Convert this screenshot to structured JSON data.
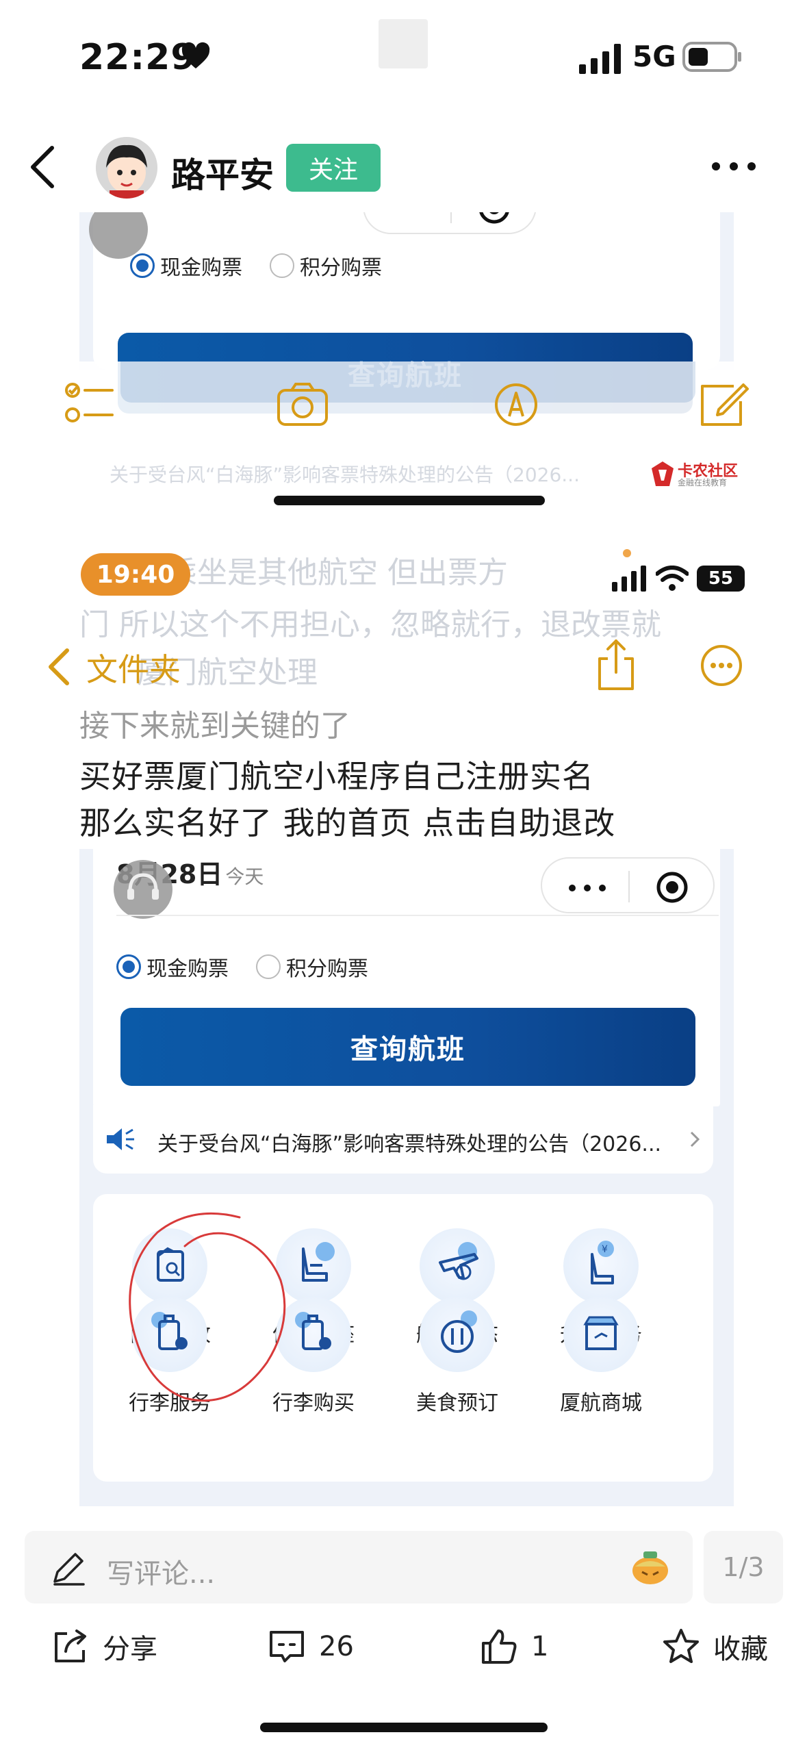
{
  "status_bar": {
    "time": "22:29",
    "network": "5G"
  },
  "post_header": {
    "author": "路平安",
    "follow_label": "关注"
  },
  "embedded": {
    "panel_top": {
      "radio_cash": "现金购票",
      "radio_points": "积分购票",
      "query_button": "查询航班",
      "notice": "关于受台风“白海豚”影响客票特殊处理的公告（2026..."
    },
    "watermark": {
      "title": "卡农社区",
      "subtitle": "金融在线教育"
    },
    "ghost_lines": [
      "际乘坐是其他航空 但出票方",
      "门 所以这个不用担心，忽略就行，退改票就",
      "厦门航空处理",
      "接下来就到关键的了"
    ],
    "device2": {
      "time": "19:40",
      "battery": "55"
    },
    "notes_header": {
      "folder_label": "文件夹"
    },
    "note_lines": [
      "买好票厦门航空小程序自己注册实名",
      "那么实名好了 我的首页 点击自助退改"
    ],
    "panel_main": {
      "date": "8月28日",
      "date_note": "今天",
      "radio_cash": "现金购票",
      "radio_points": "积分购票",
      "query_button": "查询航班",
      "notice": "关于受台风“白海豚”影响客票特殊处理的公告（2026...",
      "services": [
        {
          "label": "自助退改",
          "icon": "refund-change-icon"
        },
        {
          "label": "值机选座",
          "icon": "seat-icon"
        },
        {
          "label": "航班动态",
          "icon": "flight-status-icon"
        },
        {
          "label": "升舱服务",
          "icon": "upgrade-icon"
        },
        {
          "label": "行李服务",
          "icon": "luggage-icon"
        },
        {
          "label": "行李购买",
          "icon": "luggage-purchase-icon"
        },
        {
          "label": "美食预订",
          "icon": "meal-icon"
        },
        {
          "label": "厦航商城",
          "icon": "store-icon"
        }
      ]
    }
  },
  "comment_bar": {
    "placeholder": "写评论...",
    "page_indicator": "1/3"
  },
  "actions": {
    "share": "分享",
    "comments": "26",
    "likes": "1",
    "favorite": "收藏"
  },
  "colors": {
    "follow_green": "#3dbb8e",
    "notes_yellow": "#d79b16",
    "xiamen_blue": "#0b5aa8",
    "pill_orange": "#e8902a"
  }
}
